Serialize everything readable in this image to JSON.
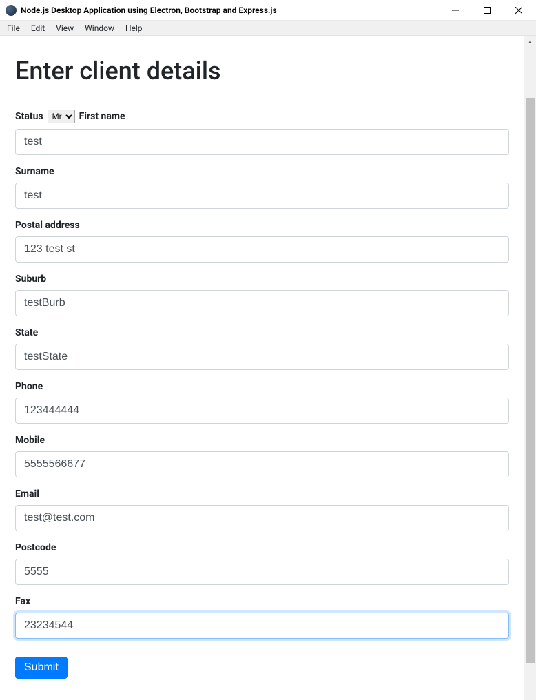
{
  "window": {
    "title": "Node.js Desktop Application using Electron, Bootstrap and Express.js"
  },
  "menubar": {
    "items": [
      "File",
      "Edit",
      "View",
      "Window",
      "Help"
    ]
  },
  "page": {
    "heading": "Enter client details"
  },
  "form": {
    "status": {
      "label": "Status",
      "selected": "Mr",
      "options": [
        "Mr"
      ]
    },
    "firstName": {
      "label": "First name",
      "value": "test"
    },
    "surname": {
      "label": "Surname",
      "value": "test"
    },
    "postalAddress": {
      "label": "Postal address",
      "value": "123 test st"
    },
    "suburb": {
      "label": "Suburb",
      "value": "testBurb"
    },
    "state": {
      "label": "State",
      "value": "testState"
    },
    "phone": {
      "label": "Phone",
      "value": "123444444"
    },
    "mobile": {
      "label": "Mobile",
      "value": "5555566677"
    },
    "email": {
      "label": "Email",
      "value": "test@test.com"
    },
    "postcode": {
      "label": "Postcode",
      "value": "5555"
    },
    "fax": {
      "label": "Fax",
      "value": "23234544"
    },
    "submit": {
      "label": "Submit"
    }
  }
}
